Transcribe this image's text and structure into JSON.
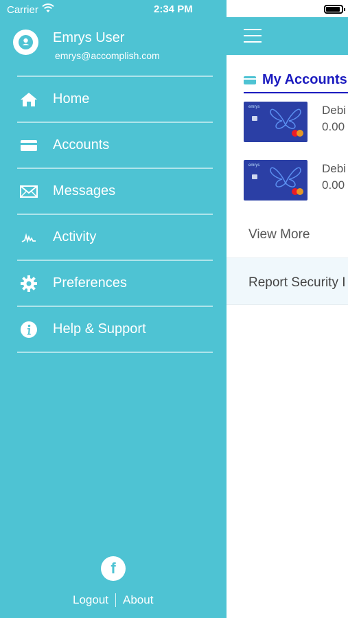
{
  "status_bar": {
    "carrier": "Carrier",
    "time": "2:34 PM"
  },
  "profile": {
    "name": "Emrys User",
    "email": "emrys@accomplish.com"
  },
  "menu": {
    "items": [
      {
        "label": "Home",
        "icon": "home-icon"
      },
      {
        "label": "Accounts",
        "icon": "card-icon"
      },
      {
        "label": "Messages",
        "icon": "envelope-icon"
      },
      {
        "label": "Activity",
        "icon": "activity-icon"
      },
      {
        "label": "Preferences",
        "icon": "gear-icon"
      },
      {
        "label": "Help & Support",
        "icon": "info-icon"
      }
    ]
  },
  "footer": {
    "logout": "Logout",
    "about": "About",
    "social_icon": "facebook-icon"
  },
  "main": {
    "section_title": "My Accounts",
    "cards": [
      {
        "label": "Debi",
        "amount": "0.00",
        "brand": "emrys"
      },
      {
        "label": "Debi",
        "amount": "0.00",
        "brand": "emrys"
      }
    ],
    "view_more": "View More",
    "report": "Report Security I"
  },
  "colors": {
    "accent": "#4ec3d3",
    "title_blue": "#1b1bbf",
    "card_blue": "#2b3fa5"
  }
}
